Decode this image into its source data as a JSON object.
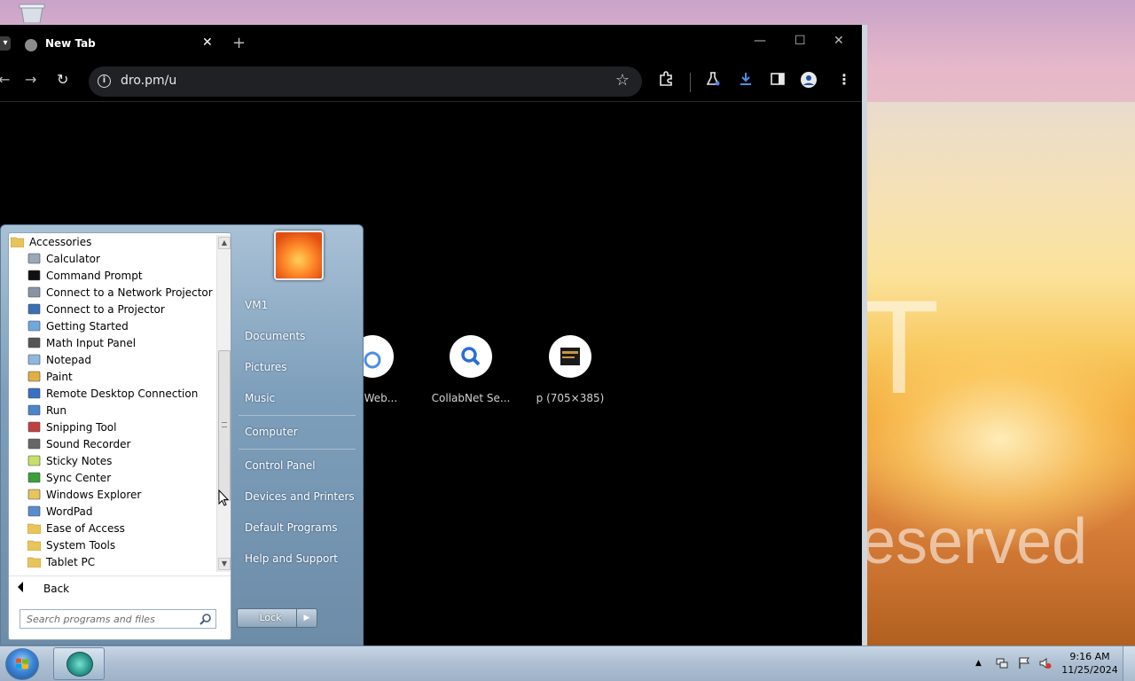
{
  "browser": {
    "tab_title": "New Tab",
    "url": "dro.pm/u",
    "shortcuts": [
      {
        "label": "he Web..."
      },
      {
        "label": "CollabNet Se..."
      },
      {
        "label": "p (705×385)"
      }
    ]
  },
  "start_menu": {
    "folder": "Accessories",
    "programs": [
      {
        "label": "Calculator",
        "icon": "calculator-icon"
      },
      {
        "label": "Command Prompt",
        "icon": "command-prompt-icon"
      },
      {
        "label": "Connect to a Network Projector",
        "icon": "network-projector-icon"
      },
      {
        "label": "Connect to a Projector",
        "icon": "projector-icon"
      },
      {
        "label": "Getting Started",
        "icon": "getting-started-icon"
      },
      {
        "label": "Math Input Panel",
        "icon": "math-input-icon"
      },
      {
        "label": "Notepad",
        "icon": "notepad-icon"
      },
      {
        "label": "Paint",
        "icon": "paint-icon"
      },
      {
        "label": "Remote Desktop Connection",
        "icon": "remote-desktop-icon"
      },
      {
        "label": "Run",
        "icon": "run-icon"
      },
      {
        "label": "Snipping Tool",
        "icon": "snipping-tool-icon"
      },
      {
        "label": "Sound Recorder",
        "icon": "sound-recorder-icon"
      },
      {
        "label": "Sticky Notes",
        "icon": "sticky-notes-icon"
      },
      {
        "label": "Sync Center",
        "icon": "sync-center-icon"
      },
      {
        "label": "Windows Explorer",
        "icon": "windows-explorer-icon"
      },
      {
        "label": "WordPad",
        "icon": "wordpad-icon"
      },
      {
        "label": "Ease of Access",
        "icon": "folder-icon"
      },
      {
        "label": "System Tools",
        "icon": "folder-icon"
      },
      {
        "label": "Tablet PC",
        "icon": "folder-icon"
      }
    ],
    "back_label": "Back",
    "search_placeholder": "Search programs and files",
    "right_items": [
      "VM1",
      "Documents",
      "Pictures",
      "Music",
      "Computer",
      "Control Panel",
      "Devices and Printers",
      "Default Programs",
      "Help and Support"
    ],
    "lock_label": "Lock"
  },
  "taskbar": {
    "time": "9:16 AM",
    "date": "11/25/2024"
  },
  "desktop": {
    "wallpaper_text_1": "T",
    "wallpaper_text_2": "eserved"
  }
}
